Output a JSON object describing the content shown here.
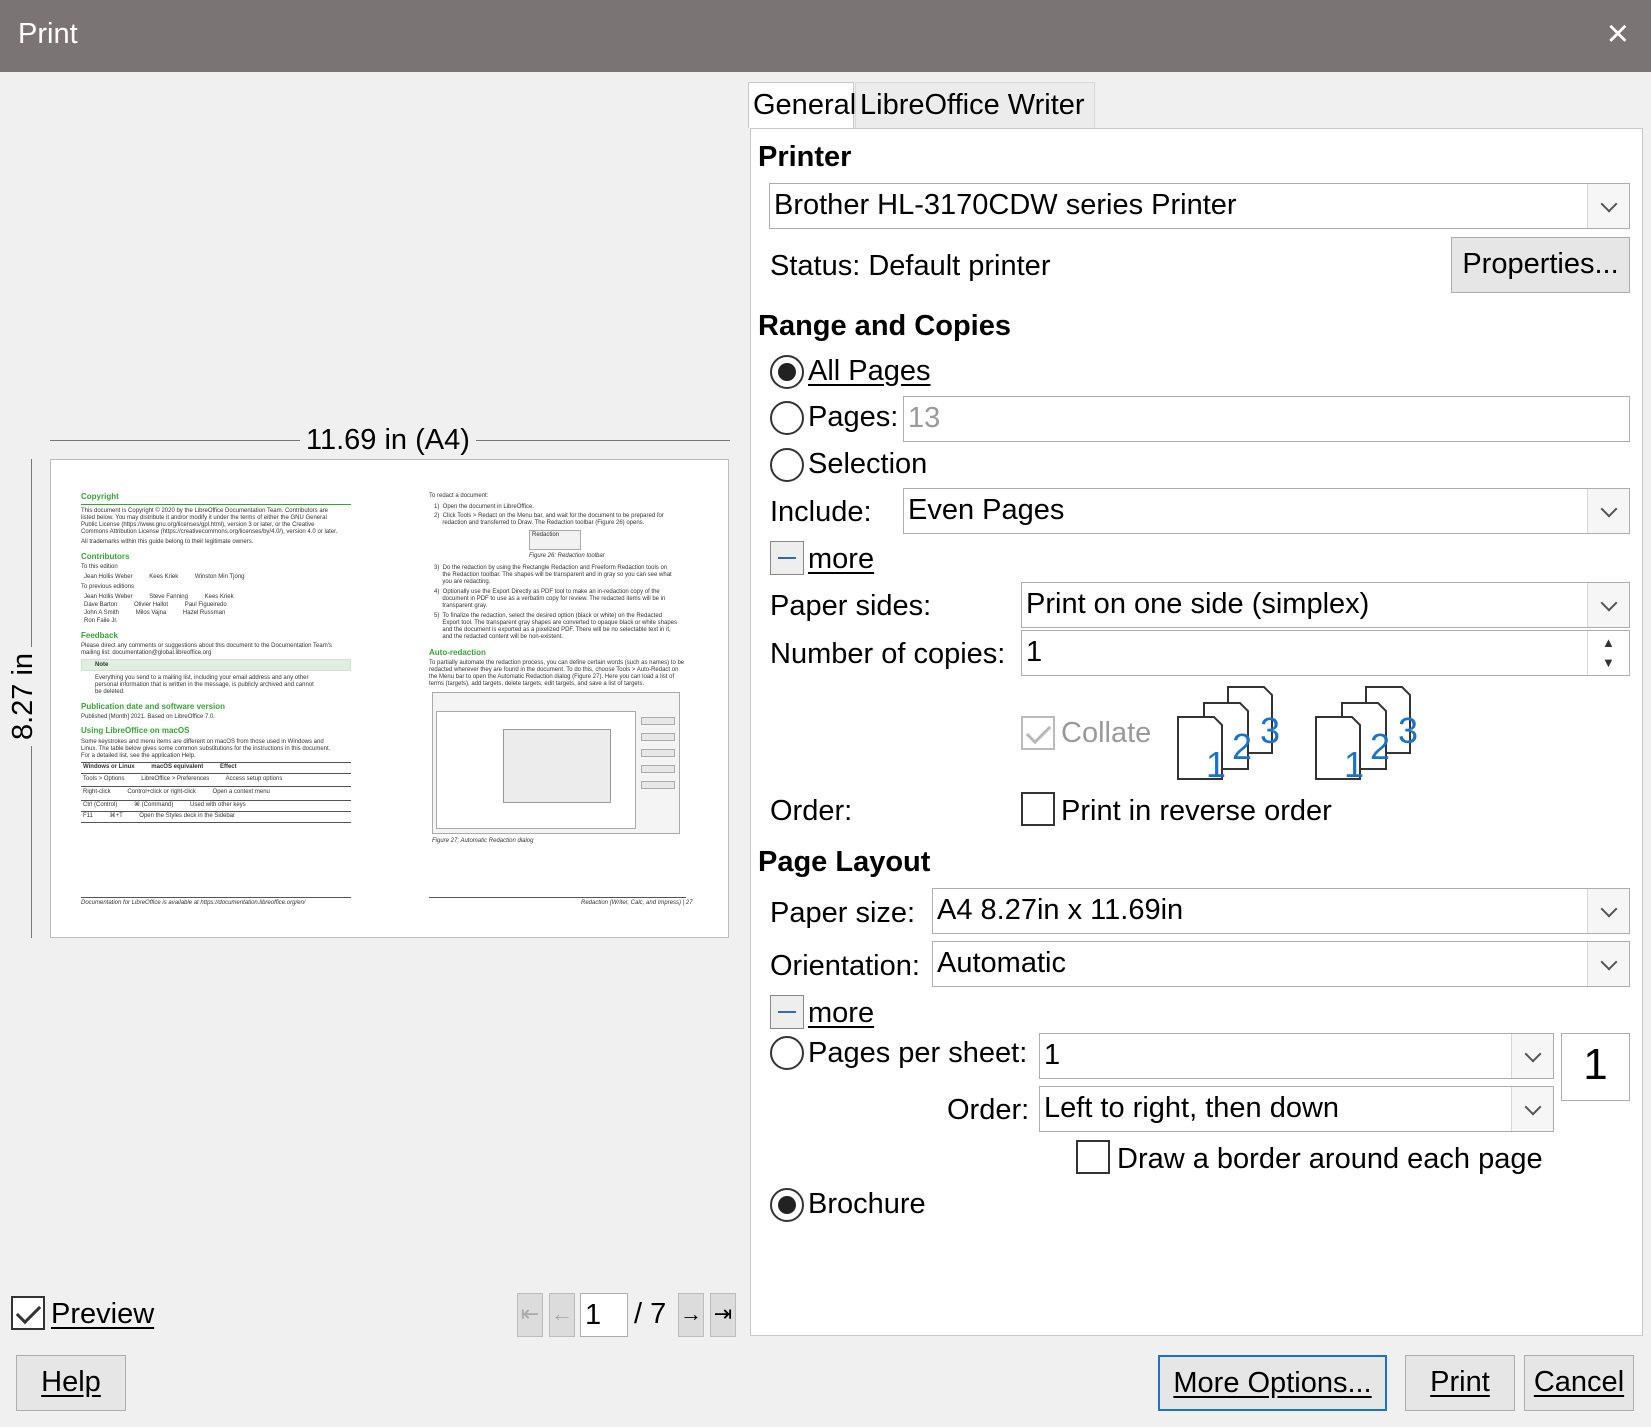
{
  "window": {
    "title": "Print",
    "close_glyph": "×",
    "close_icon": "close-icon"
  },
  "preview": {
    "width_label": "11.69 in (A4)",
    "height_label": "8.27 in",
    "left_page": {
      "h1": "Copyright",
      "t1": "This document is Copyright © 2020 by the LibreOffice Documentation Team. Contributors are",
      "t2": "listed below. You may distribute it and/or modify it under the terms of either the GNU General",
      "t3": "Public License (https://www.gnu.org/licenses/gpl.html), version 3 or later, or the Creative",
      "t4": "Commons Attribution License (https://creativecommons.org/licenses/by/4.0/), version 4.0 or later.",
      "t5": "All trademarks within this guide belong to their legitimate owners.",
      "h2": "Contributors",
      "t6": "To this edition",
      "t7": "Jean Hollis Weber          Kees Kriek          Winston Min Tjong",
      "t8": "To previous editions",
      "t9": "Jean Hollis Weber          Steve Fanning          Kees Kriek",
      "t10": "Dave Barton          Olivier Hallot          Paul Figueiredo",
      "t11": "John A Smith          Milos Vajna          Hazel Russman",
      "t12": "Ron Faile Jr.",
      "h3": "Feedback",
      "t13": "Please direct any comments or suggestions about this document to the Documentation Team's",
      "t14": "mailing list: documentation@global.libreoffice.org",
      "t15": "Note",
      "t16": "Everything you send to a mailing list, including your email address and any other",
      "t17": "personal information that is written in the message, is publicly archived and cannot",
      "t18": "be deleted.",
      "h4": "Publication date and software version",
      "t19": "Published [Month] 2021. Based on LibreOffice 7.0.",
      "h5": "Using LibreOffice on macOS",
      "t20": "Some keystrokes and menu items are different on macOS from those used in Windows and",
      "t21": "Linux. The table below gives some common substitutions for the instructions in this document.",
      "t22": "For a detailed list, see the application Help.",
      "t23": "Windows or Linux          macOS equivalent          Effect",
      "t24": "Tools > Options          LibreOffice > Preferences          Access setup options",
      "t25": "Right-click          Control+click or right-click          Open a context menu",
      "t26": "Ctrl (Control)          ⌘ (Command)          Used with other keys",
      "t27": "F11          ⌘+T          Open the Styles deck in the Sidebar",
      "footer": "Documentation for LibreOffice is available at https://documentation.libreoffice.org/en/"
    },
    "right_page": {
      "t1": "To redact a document:",
      "t2": "1)  Open the document in LibreOffice.",
      "t3": "2)  Click Tools > Redact on the Menu bar, and wait for the document to be prepared for",
      "t4": "     redaction and transferred to Draw. The Redaction toolbar (Figure 26) opens.",
      "t5": "Redaction",
      "t6": "Figure 26: Redaction toolbar",
      "t7": "3)  Do the redaction by using the Rectangle Redaction and Freeform Redaction tools on",
      "t8": "     the Redaction toolbar. The shapes will be transparent and in gray so you can see what",
      "t9": "     you are redacting.",
      "t10": "4)  Optionally use the Export Directly as PDF tool to make an in-redaction copy of the",
      "t11": "     document in PDF to use as a verbatim copy for review. The redacted items will be in",
      "t12": "     transparent gray.",
      "t13": "5)  To finalize the redaction, select the desired option (black or white) on the Redacted",
      "t14": "     Export tool. The transparent gray shapes are converted to opaque black or white shapes",
      "t15": "     and the document is exported as a pixelized PDF. There will be no selectable text in it,",
      "t16": "     and the redacted content will be non-existent.",
      "h1": "Auto-redaction",
      "t17": "To partially automate the redaction process, you can define certain words (such as names) to be",
      "t18": "redacted wherever they are found in the document. To do this, choose Tools > Auto-Redact on",
      "t19": "the Menu bar to open the Automatic Redaction dialog (Figure 27). Here you can load a list of",
      "t20": "terms (targets), add targets, delete targets, edit targets, and save a list of targets.",
      "t21": "Figure 27: Automatic Redaction dialog",
      "footer": "Redaction (Writer, Calc, and Impress) | 27"
    },
    "preview_checkbox_label": "Preview",
    "page_current": "1",
    "page_total": "/ 7"
  },
  "tabs": [
    "General",
    "LibreOffice Writer"
  ],
  "printer": {
    "section": "Printer",
    "selected": "Brother HL-3170CDW series Printer",
    "status": "Status: Default printer",
    "properties_button": "Properties..."
  },
  "range": {
    "section": "Range and Copies",
    "all_pages": "All Pages",
    "pages_label": "Pages:",
    "pages_placeholder": "13",
    "selection": "Selection",
    "include_label": "Include:",
    "include_value": "Even Pages",
    "more": "more",
    "paper_sides_label": "Paper sides:",
    "paper_sides_value": "Print on one side (simplex)",
    "copies_label": "Number of copies:",
    "copies_value": "1",
    "collate_label": "Collate",
    "order_label": "Order:",
    "reverse_label": "Print in reverse order",
    "collate_digits": [
      "1",
      "2",
      "3"
    ]
  },
  "layout": {
    "section": "Page Layout",
    "paper_size_label": "Paper size:",
    "paper_size_value": "A4 8.27in x 11.69in",
    "orientation_label": "Orientation:",
    "orientation_value": "Automatic",
    "more": "more",
    "pages_per_sheet_label": "Pages per sheet:",
    "pages_per_sheet_value": "1",
    "pages_per_sheet_preview": "1",
    "order_label": "Order:",
    "order_value": "Left to right, then down",
    "border_label": "Draw a border around each page",
    "brochure_label": "Brochure"
  },
  "buttons": {
    "help": "Help",
    "more_options": "More Options...",
    "print": "Print",
    "cancel": "Cancel"
  },
  "colors": {
    "titlebar": "#7a7574",
    "accent": "#1a73c8",
    "heading_green": "#3aa13a"
  }
}
